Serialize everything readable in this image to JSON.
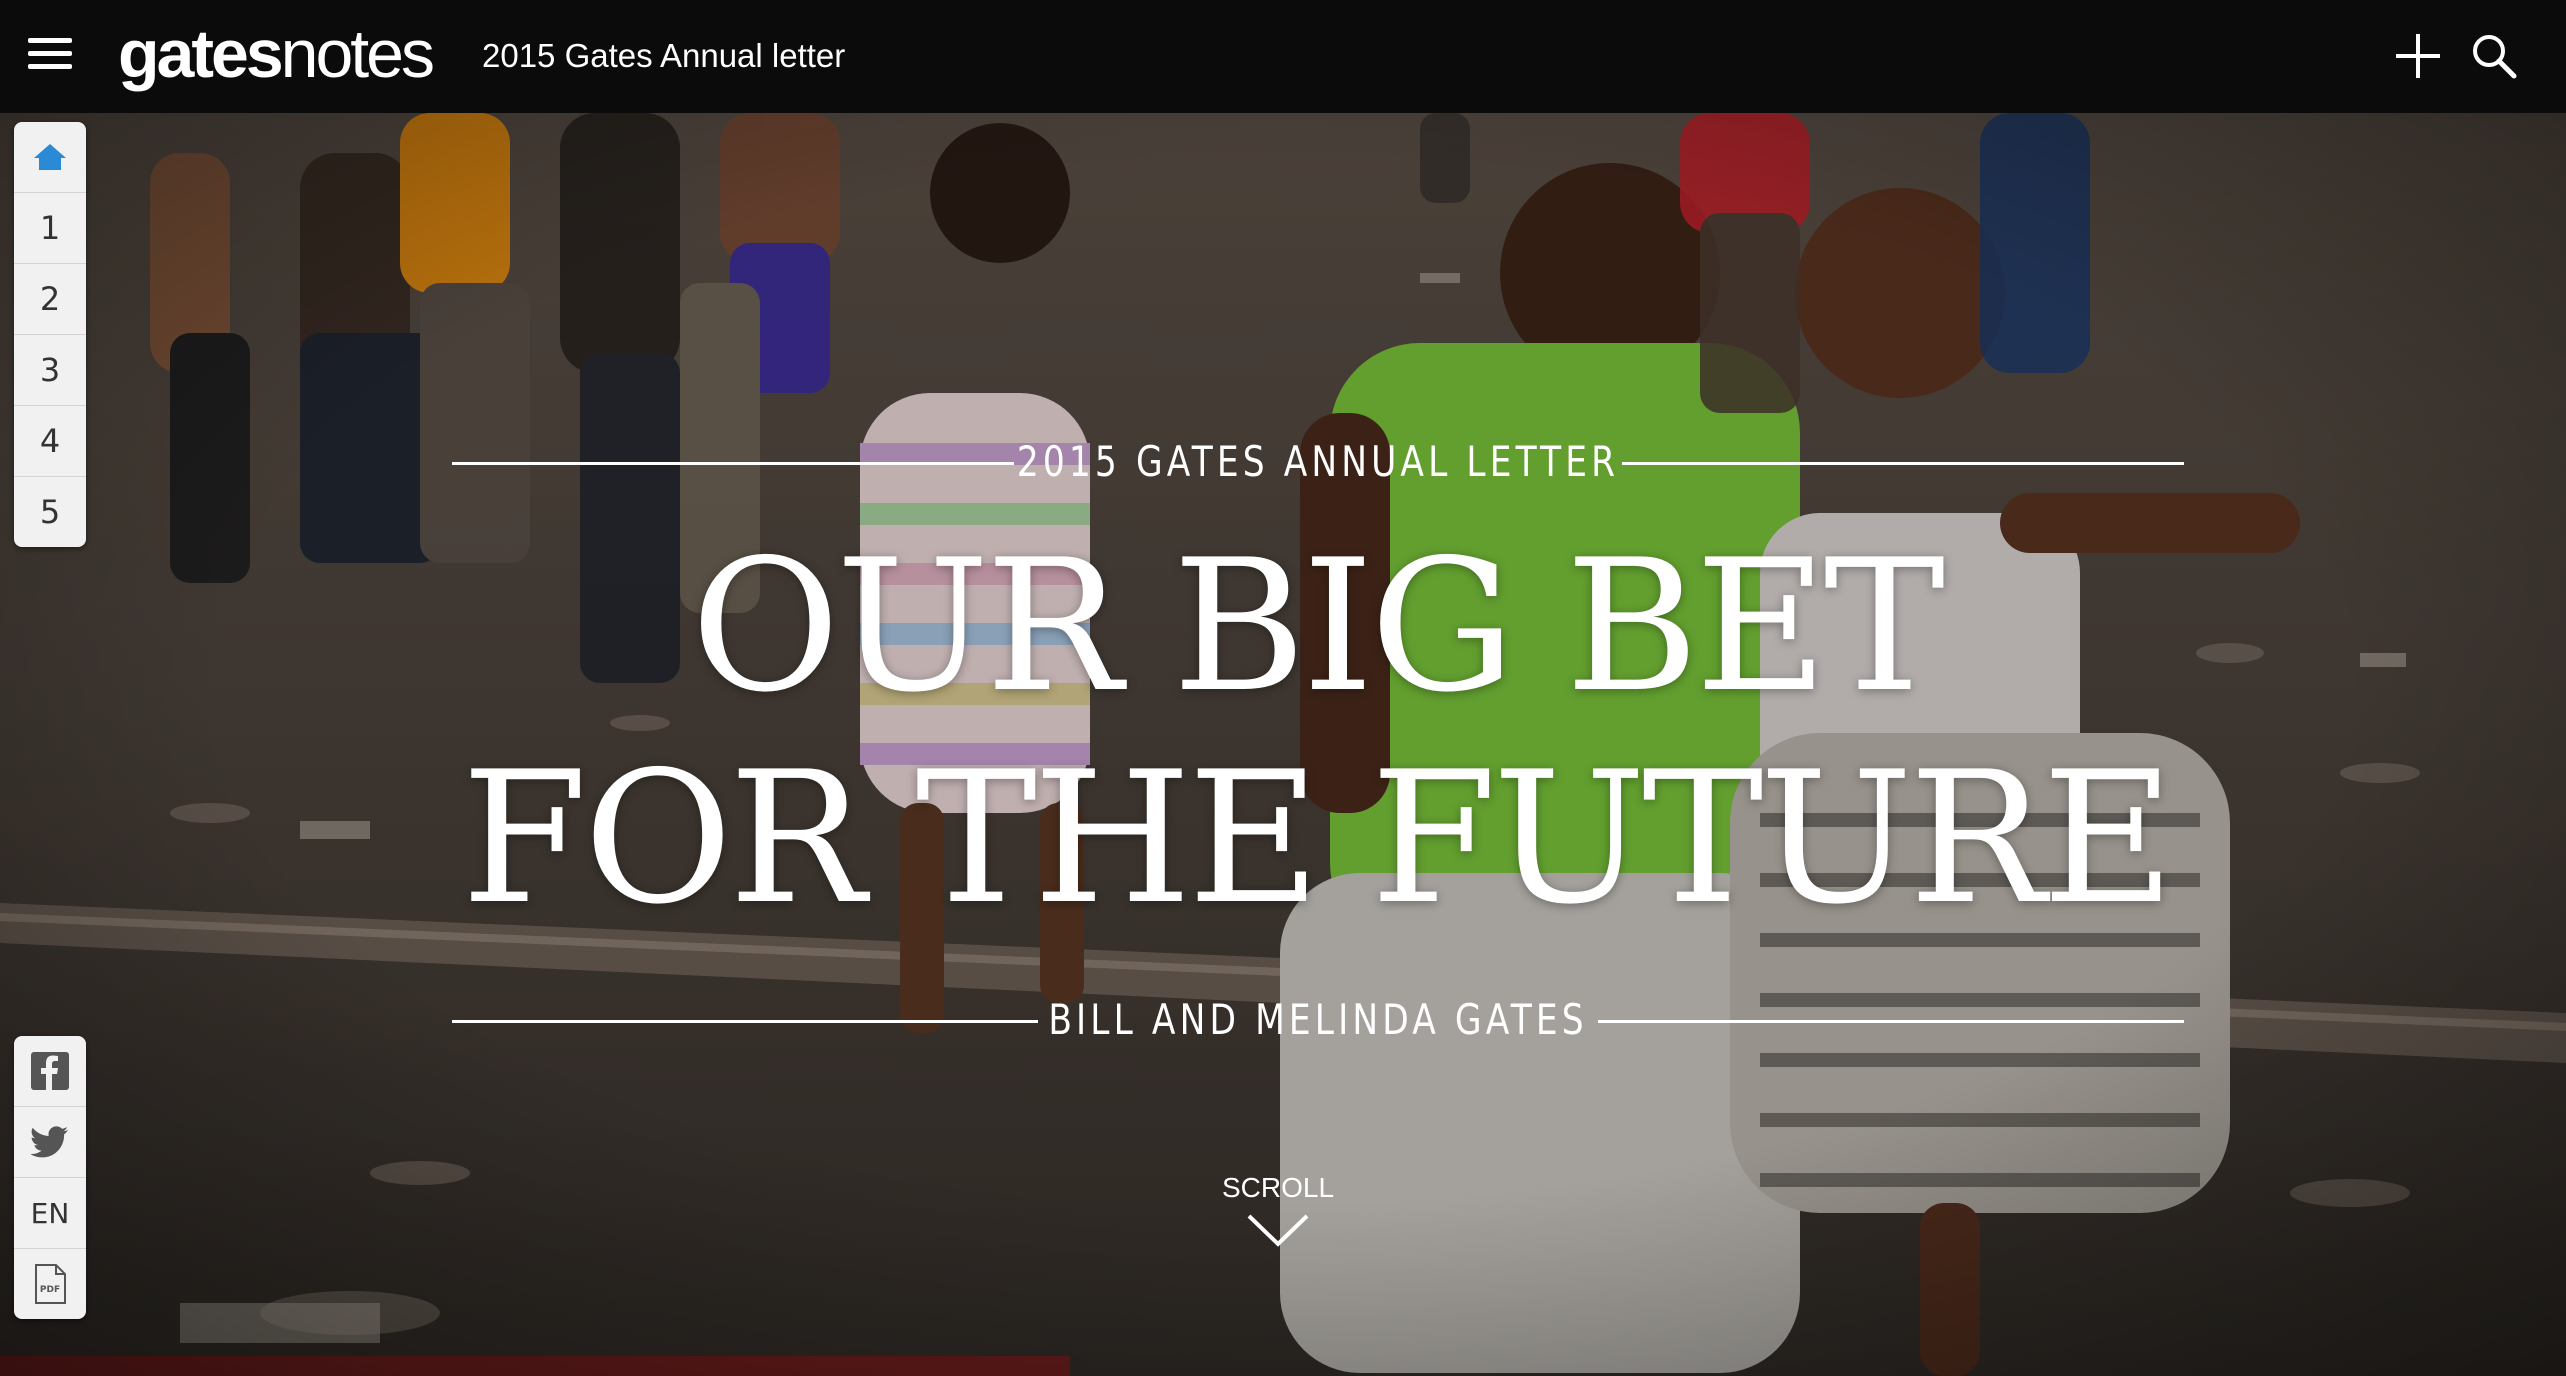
{
  "header": {
    "logo_part1": "gates",
    "logo_part2": "notes",
    "title": "2015 Gates Annual letter",
    "menu_icon": "hamburger-menu-icon",
    "add_icon": "plus-icon",
    "search_icon": "search-icon"
  },
  "side_nav": {
    "home_icon": "home-icon",
    "items": [
      "1",
      "2",
      "3",
      "4",
      "5"
    ]
  },
  "side_tools": {
    "facebook_icon": "facebook-icon",
    "twitter_icon": "twitter-icon",
    "language": "EN",
    "pdf_icon": "pdf-icon"
  },
  "hero": {
    "kicker": "2015 GATES ANNUAL LETTER",
    "headline_line1": "OUR BIG BET",
    "headline_line2": "FOR THE FUTURE",
    "byline": "BILL AND MELINDA GATES",
    "scroll_label": "SCROLL",
    "scroll_icon": "chevron-down-icon"
  }
}
